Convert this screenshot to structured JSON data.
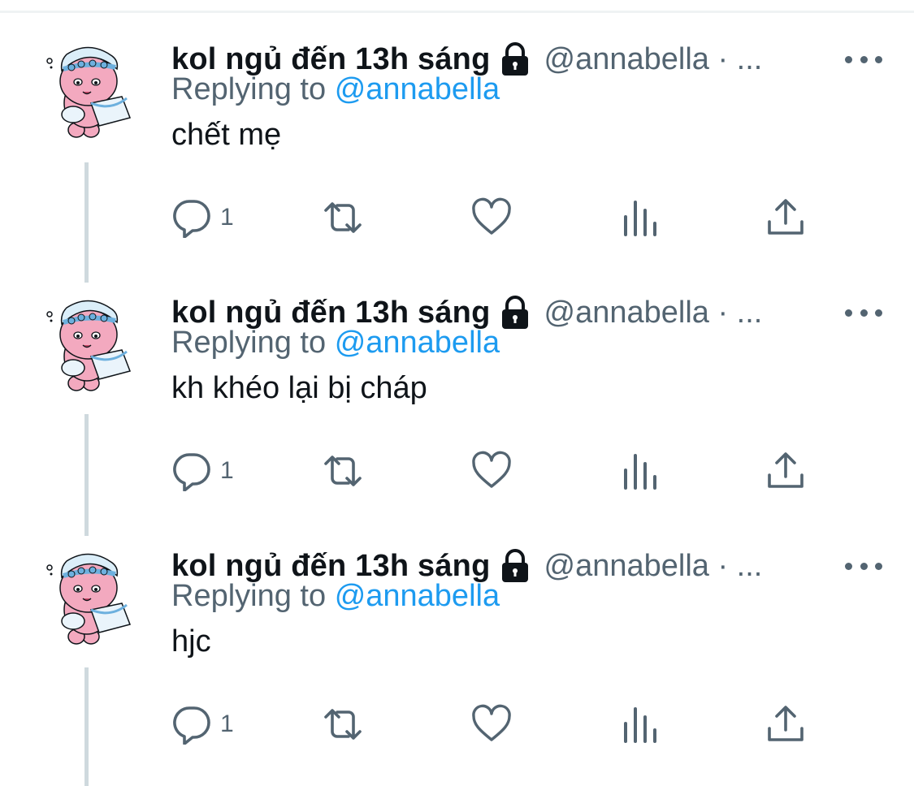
{
  "thread": {
    "tweets": [
      {
        "name": "kol ngủ đến 13h sáng",
        "handle": "@annabella · ...",
        "reply_prefix": "Replying to",
        "reply_mention": "@annabella",
        "text": "chết mẹ",
        "reply_count": "1"
      },
      {
        "name": "kol ngủ đến 13h sáng",
        "handle": "@annabella · ...",
        "reply_prefix": "Replying to",
        "reply_mention": "@annabella",
        "text": "kh khéo lại bị cháp",
        "reply_count": "1"
      },
      {
        "name": "kol ngủ đến 13h sáng",
        "handle": "@annabella · ...",
        "reply_prefix": "Replying to",
        "reply_mention": "@annabella",
        "text": "hjc",
        "reply_count": "1"
      }
    ],
    "icons": [
      "lock-icon",
      "more-icon",
      "reply-icon",
      "retweet-icon",
      "like-icon",
      "analytics-icon",
      "share-icon"
    ],
    "colors": {
      "text": "#0f1419",
      "secondary": "#536471",
      "mention": "#1d9bf0",
      "thread_line": "#cfd9de"
    }
  }
}
